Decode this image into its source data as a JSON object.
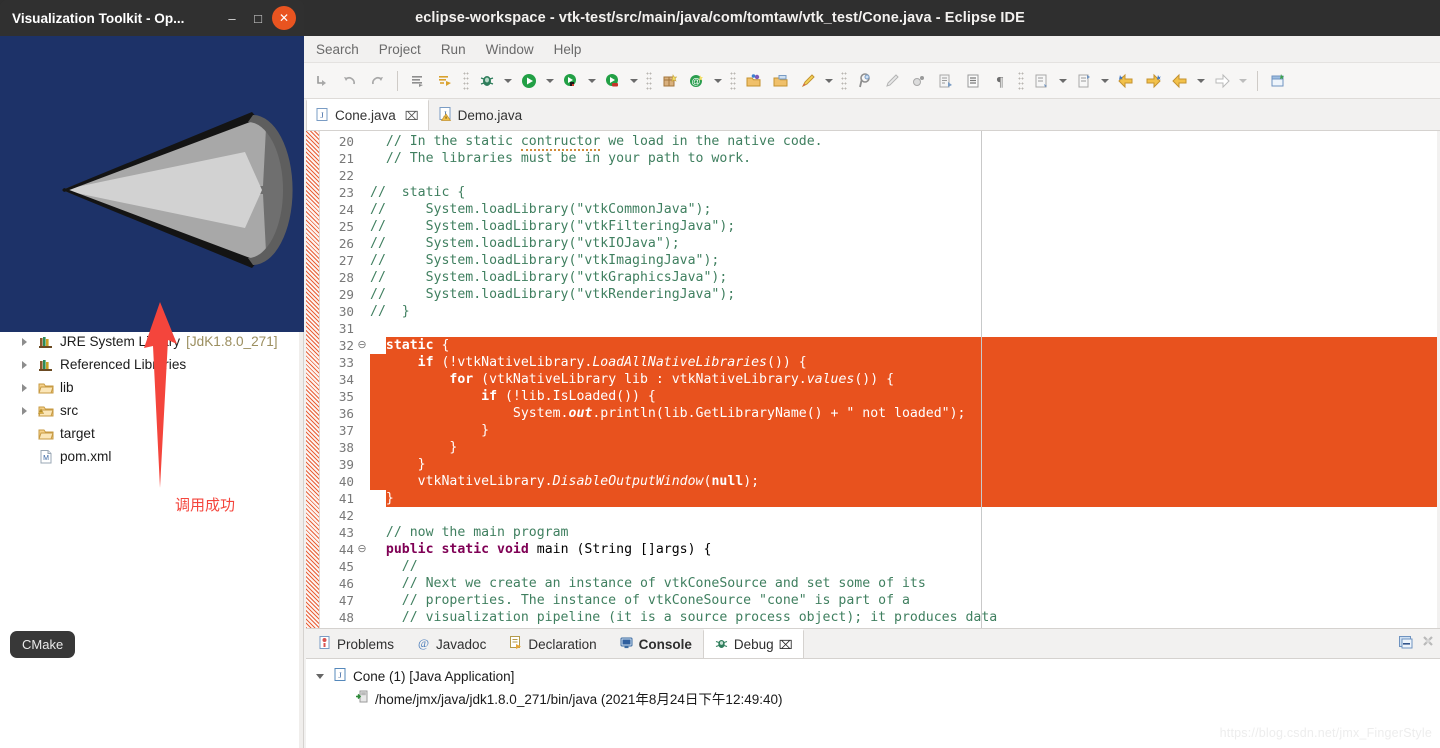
{
  "vtk_window": {
    "title": "Visualization Toolkit - Op...",
    "controls": {
      "minimize": "–",
      "maximize": "□",
      "close": "✕"
    },
    "canvas": {
      "background_color": "#1d3268",
      "object": "cone",
      "object_color": "#b9b9b9"
    }
  },
  "eclipse": {
    "title": "eclipse-workspace - vtk-test/src/main/java/com/tomtaw/vtk_test/Cone.java - Eclipse IDE",
    "menu": [
      "Search",
      "Project",
      "Run",
      "Window",
      "Help"
    ],
    "toolbar_left": [
      {
        "name": "skip-all-breakpoints-icon",
        "glyph": "⤵"
      },
      {
        "name": "undo-icon",
        "glyph": "↶"
      },
      {
        "name": "redo-icon",
        "glyph": "↷"
      },
      {
        "name": "open-task-icon",
        "glyph": "≣"
      },
      {
        "name": "new-task-icon",
        "glyph": "↳"
      },
      {
        "name": "debug-icon",
        "glyph": "☀"
      },
      {
        "name": "run-icon",
        "glyph": "▶"
      },
      {
        "name": "coverage-icon",
        "glyph": "◑"
      },
      {
        "name": "run-last-tool-icon",
        "glyph": "◕"
      },
      {
        "name": "new-java-package-icon",
        "glyph": "⊞"
      },
      {
        "name": "new-annotation-icon",
        "glyph": "Ⓖ"
      },
      {
        "name": "open-type-icon",
        "glyph": "◱"
      },
      {
        "name": "open-task-folder-icon",
        "glyph": "◰"
      },
      {
        "name": "search-icon",
        "glyph": "✐"
      }
    ],
    "toolbar_right": [
      {
        "name": "pin-icon",
        "glyph": "⚑"
      },
      {
        "name": "brush-icon",
        "glyph": "✒"
      },
      {
        "name": "toggle-mark-occurrences-icon",
        "glyph": "◌"
      },
      {
        "name": "next-annotation-icon",
        "glyph": "❐"
      },
      {
        "name": "block-selection-icon",
        "glyph": "▤"
      },
      {
        "name": "show-whitespace-icon",
        "glyph": "¶"
      },
      {
        "name": "previous-edit-icon",
        "glyph": "↱"
      },
      {
        "name": "last-edit-location-icon",
        "glyph": "↰"
      },
      {
        "name": "back-icon",
        "glyph": "⇦"
      },
      {
        "name": "forward-icon",
        "glyph": "⇨"
      },
      {
        "name": "new-window-icon",
        "glyph": "⧉"
      }
    ],
    "editor_tabs": [
      {
        "label": "Cone.java",
        "active": true,
        "closable": true,
        "icon": "java-file-icon"
      },
      {
        "label": "Demo.java",
        "active": false,
        "closable": false,
        "icon": "java-file-warning-icon"
      }
    ],
    "code": {
      "first_line_number": 20,
      "selection": {
        "from_line": 32,
        "to_line": 41,
        "color": "#e8521e"
      },
      "lines": [
        {
          "n": 20,
          "html": "<span class=\"c-cmt\">  // In the static <span class=\"spell\">contructor</span> we load in the native code.</span>"
        },
        {
          "n": 21,
          "html": "<span class=\"c-cmt\">  // The libraries must be in your path to work.</span>"
        },
        {
          "n": 22,
          "html": ""
        },
        {
          "n": 23,
          "html": "<span class=\"c-cmt\">//  static {</span>"
        },
        {
          "n": 24,
          "html": "<span class=\"c-cmt\">//     System.loadLibrary(\"vtkCommonJava\");</span>"
        },
        {
          "n": 25,
          "html": "<span class=\"c-cmt\">//     System.loadLibrary(\"vtkFilteringJava\");</span>"
        },
        {
          "n": 26,
          "html": "<span class=\"c-cmt\">//     System.loadLibrary(\"vtkIOJava\");</span>"
        },
        {
          "n": 27,
          "html": "<span class=\"c-cmt\">//     System.loadLibrary(\"vtkImagingJava\");</span>"
        },
        {
          "n": 28,
          "html": "<span class=\"c-cmt\">//     System.loadLibrary(\"vtkGraphicsJava\");</span>"
        },
        {
          "n": 29,
          "html": "<span class=\"c-cmt\">//     System.loadLibrary(\"vtkRenderingJava\");</span>"
        },
        {
          "n": 30,
          "html": "<span class=\"c-cmt\">//  }</span>"
        },
        {
          "n": 31,
          "html": ""
        },
        {
          "n": 32,
          "fold": "⊖",
          "sel": true,
          "indent": 1,
          "html": "  <span class=\"c-kw\">static</span> {"
        },
        {
          "n": 33,
          "sel": true,
          "html": "      <span class=\"c-kw\">if</span> (!vtkNativeLibrary.<span class=\"c-mth\">LoadAllNativeLibraries</span>()) {"
        },
        {
          "n": 34,
          "sel": true,
          "html": "          <span class=\"c-kw\">for</span> (vtkNativeLibrary lib : vtkNativeLibrary.<span class=\"c-mth\">values</span>()) {"
        },
        {
          "n": 35,
          "sel": true,
          "html": "              <span class=\"c-kw\">if</span> (!lib.IsLoaded()) {"
        },
        {
          "n": 36,
          "sel": true,
          "html": "                  System.<span class=\"c-fld\">out</span>.println(lib.GetLibraryName() + \" not loaded\");"
        },
        {
          "n": 37,
          "sel": true,
          "html": "              }"
        },
        {
          "n": 38,
          "sel": true,
          "html": "          }"
        },
        {
          "n": 39,
          "sel": true,
          "html": "      }"
        },
        {
          "n": 40,
          "sel": true,
          "html": "      vtkNativeLibrary.<span class=\"c-mth\">DisableOutputWindow</span>(<span class=\"c-kw\">null</span>);"
        },
        {
          "n": 41,
          "sel": true,
          "indent": 1,
          "html": "  }"
        },
        {
          "n": 42,
          "html": ""
        },
        {
          "n": 43,
          "html": "<span class=\"c-cmt\">  // now the main program</span>"
        },
        {
          "n": 44,
          "fold": "⊖",
          "html": "  <span class=\"c-kw\">public static void</span> main (String []args) {"
        },
        {
          "n": 45,
          "html": "<span class=\"c-cmt\">    //</span>"
        },
        {
          "n": 46,
          "html": "<span class=\"c-cmt\">    // Next we create an instance of vtkConeSource and set some of its</span>"
        },
        {
          "n": 47,
          "html": "<span class=\"c-cmt\">    // properties. The instance of vtkConeSource \"cone\" is part of a</span>"
        },
        {
          "n": 48,
          "html": "<span class=\"c-cmt\">    // visualization pipeline (it is a source process object); it produces data</span>"
        }
      ]
    },
    "bottom_view": {
      "tabs": [
        {
          "label": "Problems",
          "icon": "problems-icon",
          "active": false,
          "bold": false
        },
        {
          "label": "Javadoc",
          "icon": "javadoc-icon",
          "active": false,
          "bold": false
        },
        {
          "label": "Declaration",
          "icon": "declaration-icon",
          "active": false,
          "bold": false
        },
        {
          "label": "Console",
          "icon": "console-icon",
          "active": false,
          "bold": true
        },
        {
          "label": "Debug",
          "icon": "debug-icon",
          "active": true,
          "bold": false,
          "closable": true
        }
      ],
      "toolbar": [
        {
          "name": "maximize-view-icon",
          "glyph": "⧉"
        },
        {
          "name": "view-menu-icon",
          "glyph": "⚙"
        }
      ],
      "tree": [
        {
          "depth": 0,
          "expanded": true,
          "icon": "java-launch-icon",
          "label": "Cone (1) [Java Application]"
        },
        {
          "depth": 1,
          "expanded": null,
          "icon": "jvm-thread-icon",
          "label": "/home/jmx/java/jdk1.8.0_271/bin/java (2021年8月24日下午12:49:40)"
        }
      ]
    }
  },
  "project_explorer": {
    "items": [
      {
        "label": "JRE System Library",
        "suffix": "[JdK1.8.0_271]",
        "icon": "library-icon",
        "twisty": true
      },
      {
        "label": "Referenced Libraries",
        "suffix": "",
        "icon": "library-icon",
        "twisty": true
      },
      {
        "label": "lib",
        "suffix": "",
        "icon": "folder-icon",
        "twisty": true
      },
      {
        "label": "src",
        "suffix": "",
        "icon": "source-folder-icon",
        "twisty": true
      },
      {
        "label": "target",
        "suffix": "",
        "icon": "folder-icon",
        "twisty": false
      },
      {
        "label": "pom.xml",
        "suffix": "",
        "icon": "maven-file-icon",
        "twisty": false
      }
    ]
  },
  "taskbar": {
    "cmake_label": "CMake"
  },
  "annotation": {
    "text": "调用成功",
    "color": "#f4453c"
  },
  "watermark": {
    "text": "https://blog.csdn.net/jmx_FingerStyle"
  }
}
